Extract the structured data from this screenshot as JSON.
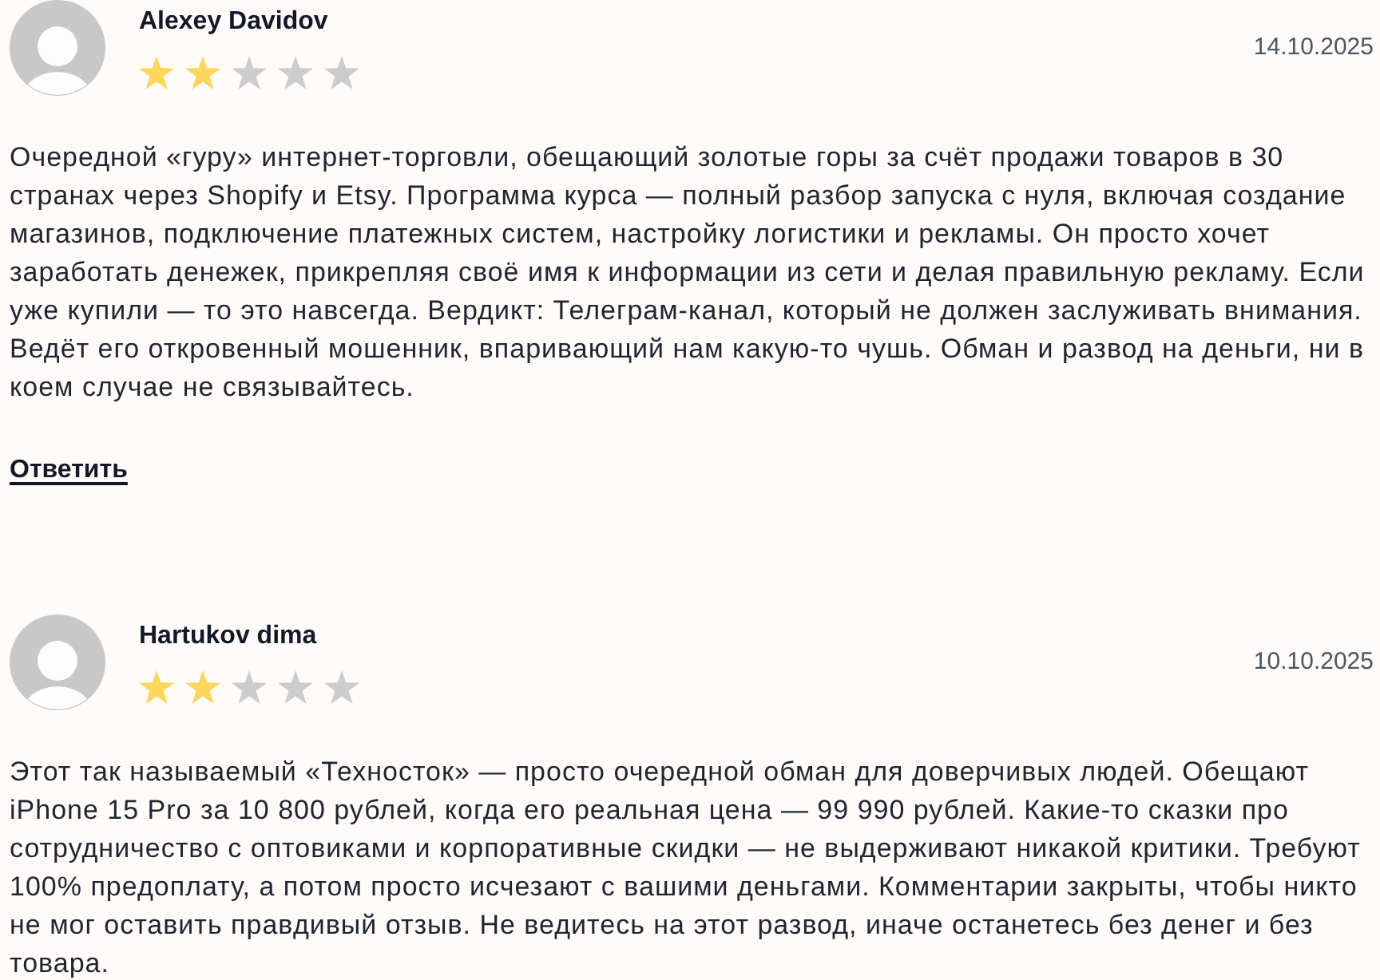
{
  "reviews": [
    {
      "author": "Alexey Davidov",
      "stars": 2,
      "date": "14.10.2025",
      "text": "Очередной «гуру» интернет-торговли, обещающий золотые горы за счёт продажи товаров в 30 странах через Shopify и Etsy. Программа курса — полный разбор запуска с нуля, включая создание магазинов, подключение платежных систем, настройку логистики и рекламы. Он просто хочет заработать денежек, прикрепляя своё имя к информации из сети и делая правильную рекламу. Если уже купили — то это навсегда. Вердикт: Телеграм-канал, который не должен заслуживать внимания. Ведёт его откровенный мошенник, впаривающий нам какую-то чушь. Обман и развод на деньги, ни в коем случае не связывайтесь.",
      "reply_link": "Ответить"
    },
    {
      "author": "Hartukov dima",
      "stars": 2,
      "date": "10.10.2025",
      "text": "Этот так называемый «Техносток» — просто очередной обман для доверчивых людей. Обещают iPhone 15 Pro за 10 800 рублей, когда его реальная цена — 99 990 рублей. Какие-то сказки про сотрудничество с оптовиками и корпоративные скидки — не выдерживают никакой критики. Требуют 100% предоплату, а потом просто исчезают с вашими деньгами. Комментарии закрыты, чтобы никто не мог оставить правдивый отзыв. Не ведитесь на этот развод, иначе останетесь без денег и без товара."
    }
  ]
}
